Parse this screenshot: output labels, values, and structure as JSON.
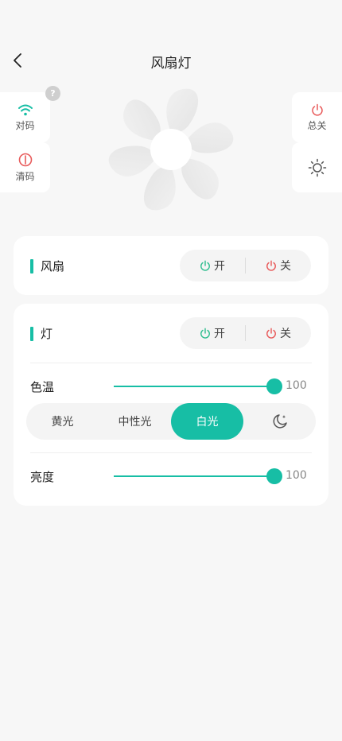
{
  "header": {
    "title": "风扇灯"
  },
  "left_buttons": [
    {
      "label": "对码",
      "icon": "wifi-icon"
    },
    {
      "label": "清码",
      "icon": "clear-code-icon"
    }
  ],
  "help_badge": "?",
  "right_buttons": [
    {
      "label": "总关",
      "icon": "power-icon"
    },
    {
      "label": "",
      "icon": "brightness-sun-icon"
    }
  ],
  "fan_section": {
    "title": "风扇",
    "on_label": "开",
    "off_label": "关"
  },
  "light_section": {
    "title": "灯",
    "on_label": "开",
    "off_label": "关",
    "color_temp": {
      "label": "色温",
      "value": 100,
      "display": "100"
    },
    "modes": [
      {
        "label": "黄光",
        "active": false
      },
      {
        "label": "中性光",
        "active": false
      },
      {
        "label": "白光",
        "active": true
      },
      {
        "label": "",
        "icon": "moon-night-icon",
        "active": false
      }
    ],
    "brightness": {
      "label": "亮度",
      "value": 100,
      "display": "100"
    }
  },
  "colors": {
    "accent": "#17bea5",
    "on": "#2ebd8e",
    "off": "#e85a5a",
    "background": "#f7f7f7"
  }
}
